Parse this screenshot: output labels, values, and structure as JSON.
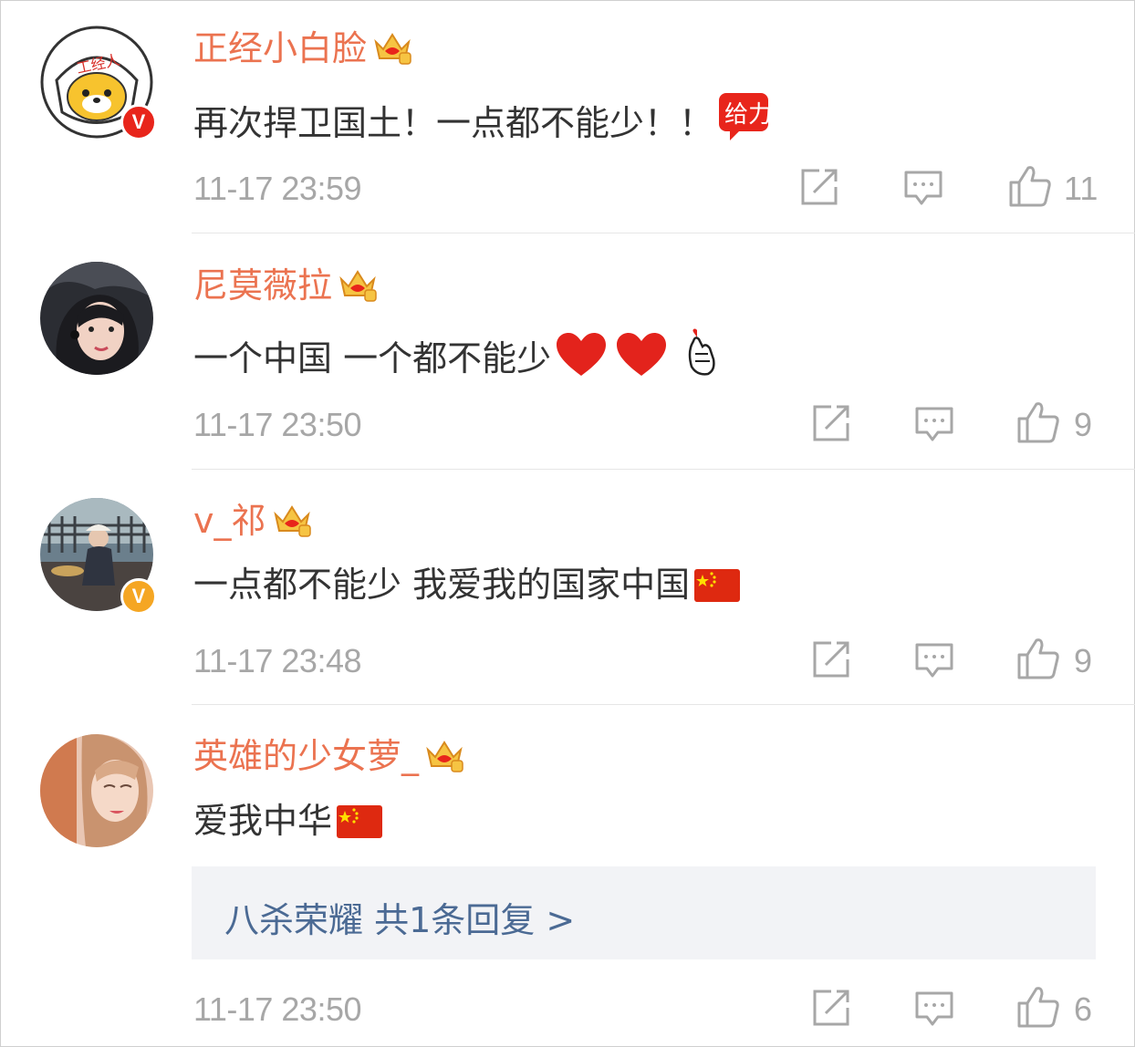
{
  "colors": {
    "username": "#eb7350",
    "body": "#333333",
    "meta": "#a7a7a7",
    "link": "#4b6a94",
    "reply_bg": "#f2f3f6"
  },
  "comments": [
    {
      "user": "正经小白脸",
      "text": "再次捍卫国土！一点都不能少！！",
      "emojis": [
        "geili-sticker"
      ],
      "time": "11-17 23:59",
      "likes": "11",
      "verified": "red",
      "avatar_label": "工经人"
    },
    {
      "user": "尼莫薇拉",
      "text": "一个中国 一个都不能少",
      "emojis": [
        "heart-emoji",
        "heart-emoji",
        "finger-heart-emoji"
      ],
      "time": "11-17 23:50",
      "likes": "9",
      "verified": ""
    },
    {
      "user": "v_祁",
      "text": "一点都不能少 我爱我的国家中国",
      "emojis": [
        "china-flag-emoji"
      ],
      "time": "11-17 23:48",
      "likes": "9",
      "verified": "gold"
    },
    {
      "user": "英雄的少女萝_",
      "text": "爱我中华",
      "emojis": [
        "china-flag-emoji"
      ],
      "time": "11-17 23:50",
      "likes": "6",
      "verified": "",
      "reply": "八杀荣耀  共1条回复 >"
    }
  ],
  "geili_label": "给力",
  "icons": {
    "share": "share-icon",
    "comment": "comment-icon",
    "like": "thumbs-up-icon",
    "crown": "crown-badge-icon"
  }
}
